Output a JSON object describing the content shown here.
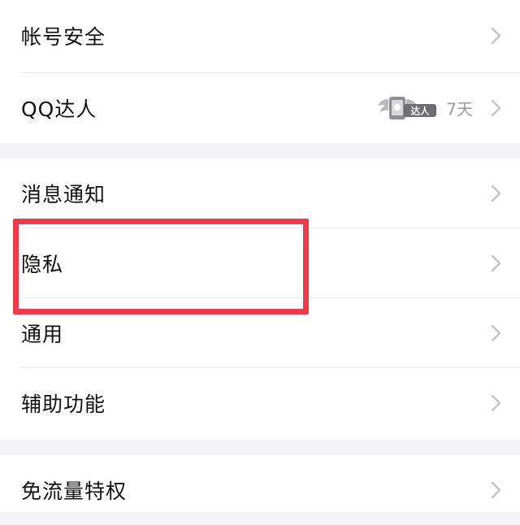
{
  "groups": [
    {
      "items": [
        {
          "label": "帐号安全"
        },
        {
          "label": "QQ达人",
          "badge_label": "达人",
          "badge_value": "7天"
        }
      ]
    },
    {
      "items": [
        {
          "label": "消息通知"
        },
        {
          "label": "隐私"
        },
        {
          "label": "通用"
        },
        {
          "label": "辅助功能"
        }
      ]
    },
    {
      "items": [
        {
          "label": "免流量特权"
        }
      ]
    }
  ],
  "colors": {
    "background": "#f2f2f7",
    "highlight": "#f2394b",
    "chevron": "#c4c4c8"
  }
}
